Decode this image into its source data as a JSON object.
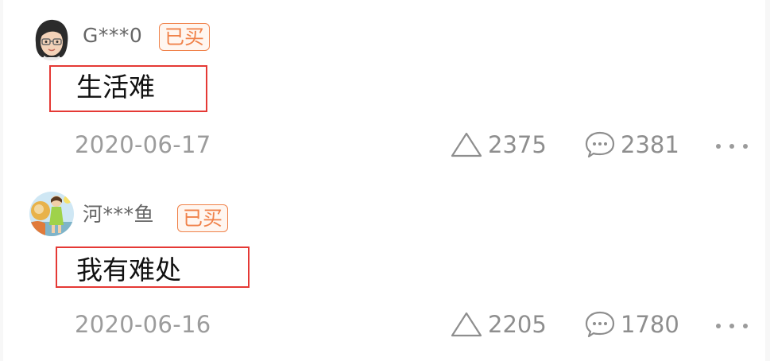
{
  "comments": [
    {
      "username": "G***0",
      "badge": "已买",
      "text": "生活难",
      "date": "2020-06-17",
      "likes": "2375",
      "replies": "2381",
      "avatar_icon": "cartoon-girl-glasses-icon"
    },
    {
      "username": "河***鱼",
      "badge": "已买",
      "text": "我有难处",
      "date": "2020-06-16",
      "likes": "2205",
      "replies": "1780",
      "avatar_icon": "colorful-character-icon"
    }
  ],
  "colors": {
    "badge": "#f0824a",
    "highlight_box": "#e53935",
    "meta_text": "#9c9c9c"
  }
}
